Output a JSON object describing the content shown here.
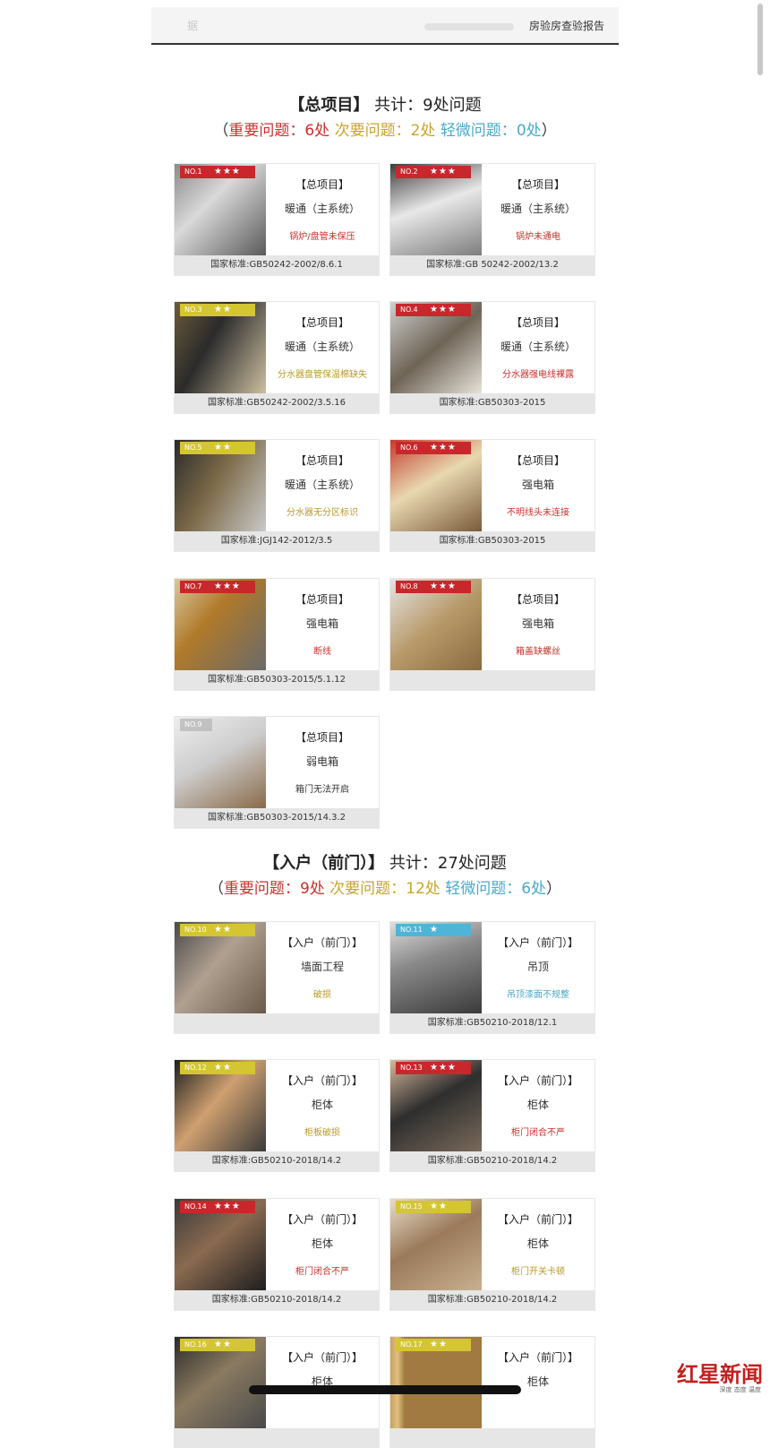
{
  "header": {
    "left_text": "据",
    "right_text": "房验房查验报告"
  },
  "sections": [
    {
      "title": "【总项目】",
      "total": "共计：9处问题",
      "paren_open": "（",
      "major_label": "重要问题：",
      "major_count": "6处",
      "minor_label": "次要问题：",
      "minor_count": "2处",
      "slight_label": "轻微问题：",
      "slight_count": "0处",
      "paren_close": "）"
    },
    {
      "title": "【入户（前门）】",
      "total": "共计：27处问题",
      "paren_open": "（",
      "major_label": "重要问题：",
      "major_count": "9处",
      "minor_label": "次要问题：",
      "minor_count": "12处",
      "slight_label": "轻微问题：",
      "slight_count": "6处",
      "paren_close": "）"
    }
  ],
  "cards": [
    {
      "no": "NO.1",
      "stars": "★★★",
      "level": "red",
      "category": "【总项目】",
      "system": "暖通（主系统）",
      "issue": "锅炉/盘管未保压",
      "standard": "国家标准:GB50242-2002/8.6.1"
    },
    {
      "no": "NO.2",
      "stars": "★★★",
      "level": "red",
      "category": "【总项目】",
      "system": "暖通（主系统）",
      "issue": "锅炉未通电",
      "standard": "国家标准:GB 50242-2002/13.2"
    },
    {
      "no": "NO.3",
      "stars": "★★",
      "level": "yel",
      "category": "【总项目】",
      "system": "暖通（主系统）",
      "issue": "分水器盘管保温棉缺失",
      "standard": "国家标准:GB50242-2002/3.5.16"
    },
    {
      "no": "NO.4",
      "stars": "★★★",
      "level": "red",
      "category": "【总项目】",
      "system": "暖通（主系统）",
      "issue": "分水器强电线裸露",
      "standard": "国家标准:GB50303-2015"
    },
    {
      "no": "NO.5",
      "stars": "★★",
      "level": "yel",
      "category": "【总项目】",
      "system": "暖通（主系统）",
      "issue": "分水器无分区标识",
      "standard": "国家标准:JGJ142-2012/3.5"
    },
    {
      "no": "NO.6",
      "stars": "★★★",
      "level": "red",
      "category": "【总项目】",
      "system": "强电箱",
      "issue": "不明线头未连接",
      "standard": "国家标准:GB50303-2015"
    },
    {
      "no": "NO.7",
      "stars": "★★★",
      "level": "red",
      "category": "【总项目】",
      "system": "强电箱",
      "issue": "断线",
      "standard": "国家标准:GB50303-2015/5.1.12"
    },
    {
      "no": "NO.8",
      "stars": "★★★",
      "level": "red",
      "category": "【总项目】",
      "system": "强电箱",
      "issue": "箱盖缺螺丝",
      "standard": ""
    },
    {
      "no": "NO.9",
      "stars": "",
      "level": "none",
      "category": "【总项目】",
      "system": "弱电箱",
      "issue": "箱门无法开启",
      "standard": "国家标准:GB50303-2015/14.3.2"
    },
    {
      "no": "NO.10",
      "stars": "★★",
      "level": "yel",
      "category": "【入户（前门）】",
      "system": "墙面工程",
      "issue": "破损",
      "standard": ""
    },
    {
      "no": "NO.11",
      "stars": "★",
      "level": "blue",
      "category": "【入户（前门）】",
      "system": "吊顶",
      "issue": "吊顶漆面不规整",
      "standard": "国家标准:GB50210-2018/12.1"
    },
    {
      "no": "NO.12",
      "stars": "★★",
      "level": "yel",
      "category": "【入户（前门）】",
      "system": "柜体",
      "issue": "柜板破损",
      "standard": "国家标准:GB50210-2018/14.2"
    },
    {
      "no": "NO.13",
      "stars": "★★★",
      "level": "red",
      "category": "【入户（前门）】",
      "system": "柜体",
      "issue": "柜门闭合不严",
      "standard": "国家标准:GB50210-2018/14.2"
    },
    {
      "no": "NO.14",
      "stars": "★★★",
      "level": "red",
      "category": "【入户（前门）】",
      "system": "柜体",
      "issue": "柜门闭合不严",
      "standard": "国家标准:GB50210-2018/14.2"
    },
    {
      "no": "NO.15",
      "stars": "★★",
      "level": "yel",
      "category": "【入户（前门）】",
      "system": "柜体",
      "issue": "柜门开关卡顿",
      "standard": "国家标准:GB50210-2018/14.2"
    },
    {
      "no": "NO.16",
      "stars": "★★",
      "level": "yel",
      "category": "【入户（前门）】",
      "system": "柜体",
      "issue": "",
      "standard": ""
    },
    {
      "no": "NO.17",
      "stars": "★★",
      "level": "yel",
      "category": "【入户（前门）】",
      "system": "柜体",
      "issue": "",
      "standard": ""
    }
  ],
  "watermark": {
    "title": "红星新闻",
    "subtitle": "深度 态度 温度"
  },
  "colors": {
    "major": "#c9302c",
    "minor": "#c8a42a",
    "slight": "#49a9c9"
  }
}
